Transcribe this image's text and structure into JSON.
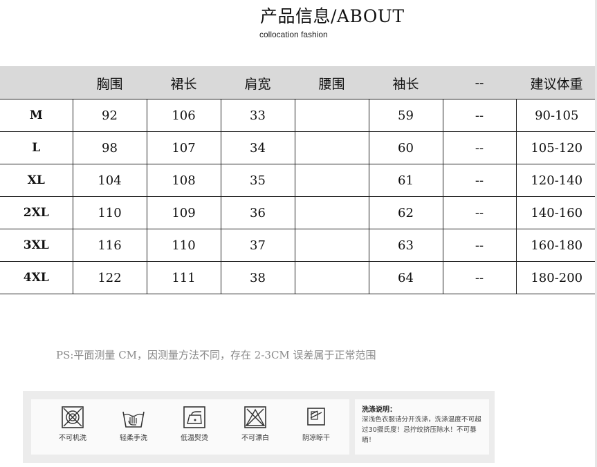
{
  "header": {
    "title": "产品信息/ABOUT",
    "subtitle": "collocation fashion"
  },
  "table": {
    "columns": [
      "",
      "胸围",
      "裙长",
      "肩宽",
      "腰围",
      "袖长",
      "--",
      "建议体重"
    ],
    "rows": [
      [
        "M",
        "92",
        "106",
        "33",
        "",
        "59",
        "--",
        "90-105"
      ],
      [
        "L",
        "98",
        "107",
        "34",
        "",
        "60",
        "--",
        "105-120"
      ],
      [
        "XL",
        "104",
        "108",
        "35",
        "",
        "61",
        "--",
        "120-140"
      ],
      [
        "2XL",
        "110",
        "109",
        "36",
        "",
        "62",
        "--",
        "140-160"
      ],
      [
        "3XL",
        "116",
        "110",
        "37",
        "",
        "63",
        "--",
        "160-180"
      ],
      [
        "4XL",
        "122",
        "111",
        "38",
        "",
        "64",
        "--",
        "180-200"
      ]
    ]
  },
  "note": "PS:平面测量 CM，因测量方法不同，存在 2-3CM 误差属于正常范围",
  "care": {
    "icons": [
      {
        "icon": "no-machine-wash-icon",
        "label": "不可机洗"
      },
      {
        "icon": "hand-wash-icon",
        "label": "轻柔手洗"
      },
      {
        "icon": "low-iron-icon",
        "label": "低温熨烫"
      },
      {
        "icon": "no-bleach-icon",
        "label": "不可漂白"
      },
      {
        "icon": "shade-dry-icon",
        "label": "阴凉晾干"
      }
    ],
    "heading": "洗涤说明：",
    "body": "深浅色衣服请分开洗涤，洗涤温度不可超过30摄氏度！忌拧绞挤压除水！不可暴晒！"
  }
}
